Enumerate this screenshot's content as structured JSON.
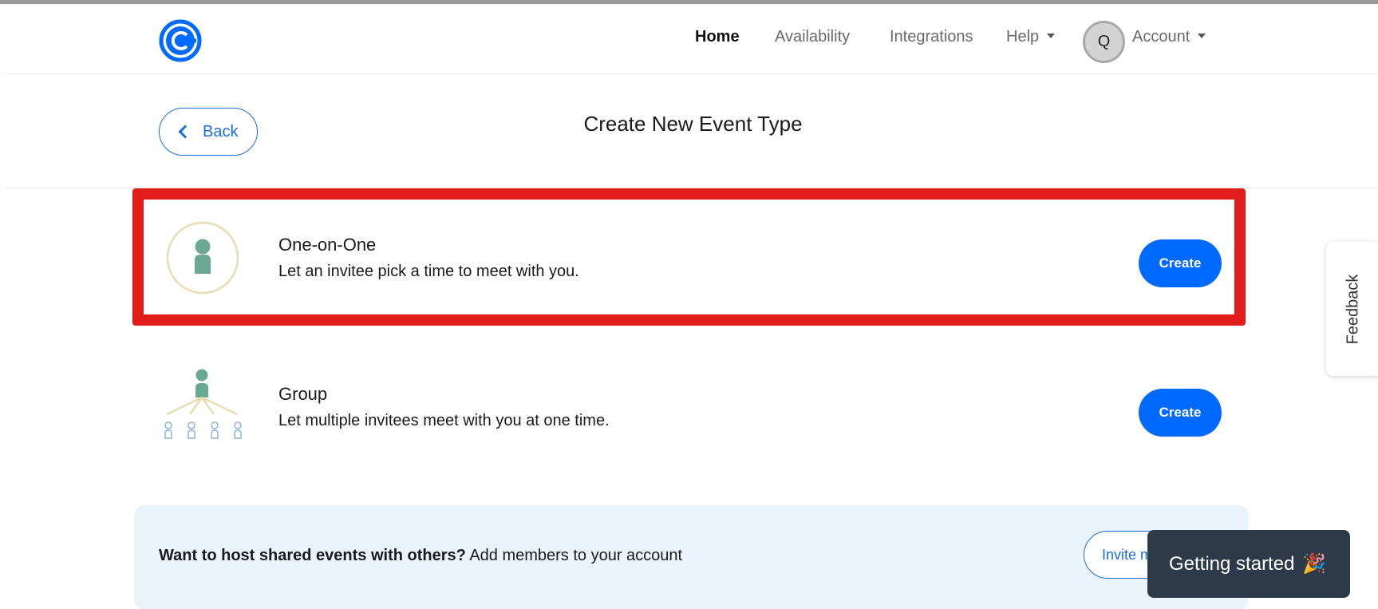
{
  "header": {
    "nav": [
      {
        "label": "Home",
        "active": true
      },
      {
        "label": "Availability",
        "active": false
      },
      {
        "label": "Integrations",
        "active": false
      },
      {
        "label": "Help",
        "active": false
      }
    ],
    "avatar_initial": "Q",
    "account_label": "Account"
  },
  "subheader": {
    "back_label": "Back",
    "title": "Create New Event Type"
  },
  "event_types": [
    {
      "name": "One-on-One",
      "description": "Let an invitee pick a time to meet with you.",
      "button": "Create",
      "icon": "one-on-one-icon",
      "highlighted": true
    },
    {
      "name": "Group",
      "description": "Let multiple invitees meet with you at one time.",
      "button": "Create",
      "icon": "group-icon",
      "highlighted": false
    }
  ],
  "promo": {
    "bold_text": "Want to host shared events with others?",
    "text": " Add members to your account",
    "button": "Invite m"
  },
  "feedback_label": "Feedback",
  "getting_started": {
    "label": "Getting started",
    "emoji": "🎉"
  },
  "colors": {
    "accent": "#0069ff",
    "highlight": "#e21b1b",
    "icon_green": "#6aa892",
    "icon_ring": "#e6ddb0"
  }
}
